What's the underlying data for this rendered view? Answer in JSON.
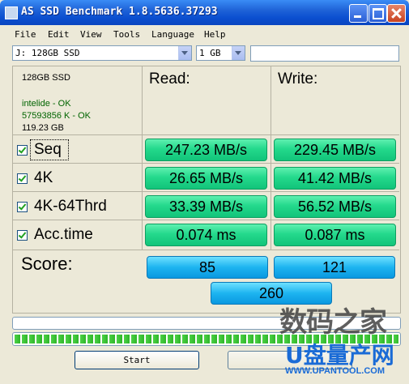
{
  "window": {
    "title": "AS SSD Benchmark 1.8.5636.37293"
  },
  "menu": [
    "File",
    "Edit",
    "View",
    "Tools",
    "Language",
    "Help"
  ],
  "toolbar": {
    "drive_selected": "J: 128GB SSD",
    "size_selected": "1 GB",
    "text_value": ""
  },
  "drive_info": {
    "name": "128GB SSD",
    "driver": "intelide - OK",
    "alignment": "57593856 K - OK",
    "capacity": "119.23 GB"
  },
  "columns": {
    "read": "Read:",
    "write": "Write:"
  },
  "tests": [
    {
      "label": "Seq",
      "checked": true,
      "read": "247.23 MB/s",
      "write": "229.45 MB/s"
    },
    {
      "label": "4K",
      "checked": true,
      "read": "26.65 MB/s",
      "write": "41.42 MB/s"
    },
    {
      "label": "4K-64Thrd",
      "checked": true,
      "read": "33.39 MB/s",
      "write": "56.52 MB/s"
    },
    {
      "label": "Acc.time",
      "checked": true,
      "read": "0.074 ms",
      "write": "0.087 ms"
    }
  ],
  "score": {
    "label": "Score:",
    "read": "85",
    "write": "121",
    "total": "260"
  },
  "progress": {
    "top_fraction": 0.0,
    "bottom_fraction": 1.0
  },
  "buttons": {
    "start": "Start",
    "abort": ""
  },
  "watermark": {
    "line1": "数码之家",
    "line2": "U盘量产网",
    "line3": "WWW.UPANTOOL.COM"
  },
  "colors": {
    "result_green": "#24d98c",
    "score_blue": "#1db4f0",
    "titlebar": "#0b4fd0"
  }
}
